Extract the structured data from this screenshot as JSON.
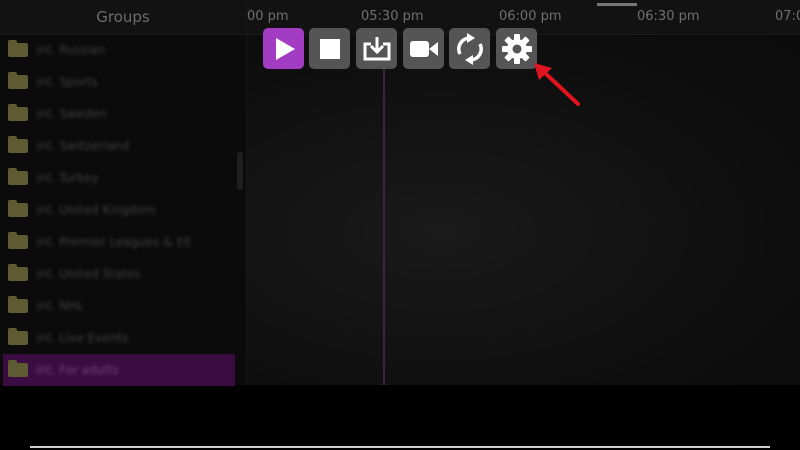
{
  "groups_panel": {
    "title": "Groups",
    "items": [
      {
        "label": "int. Russian"
      },
      {
        "label": "int. Sports"
      },
      {
        "label": "int. Sweden"
      },
      {
        "label": "int. Switzerland"
      },
      {
        "label": "int. Turkey"
      },
      {
        "label": "int. United Kingdom"
      },
      {
        "label": "int. Premier Leagues & EE"
      },
      {
        "label": "int. United States"
      },
      {
        "label": "int. NHL"
      },
      {
        "label": "int. Live Events"
      },
      {
        "label": "int. For adults"
      }
    ],
    "selected_index": 10
  },
  "timeline": {
    "labels": [
      "00 pm",
      "05:30 pm",
      "06:00 pm",
      "06:30 pm",
      "07:0"
    ]
  },
  "toolbar": {
    "buttons": [
      {
        "icon": "play-icon",
        "active": true
      },
      {
        "icon": "stop-icon",
        "active": false
      },
      {
        "icon": "download-icon",
        "active": false
      },
      {
        "icon": "record-icon",
        "active": false
      },
      {
        "icon": "refresh-icon",
        "active": false
      },
      {
        "icon": "gear-icon",
        "active": false
      }
    ]
  },
  "colors": {
    "accent": "#a23cc2",
    "selected_row": "#3b0c42",
    "button": "#555555",
    "annotation_arrow": "#e0141e"
  }
}
